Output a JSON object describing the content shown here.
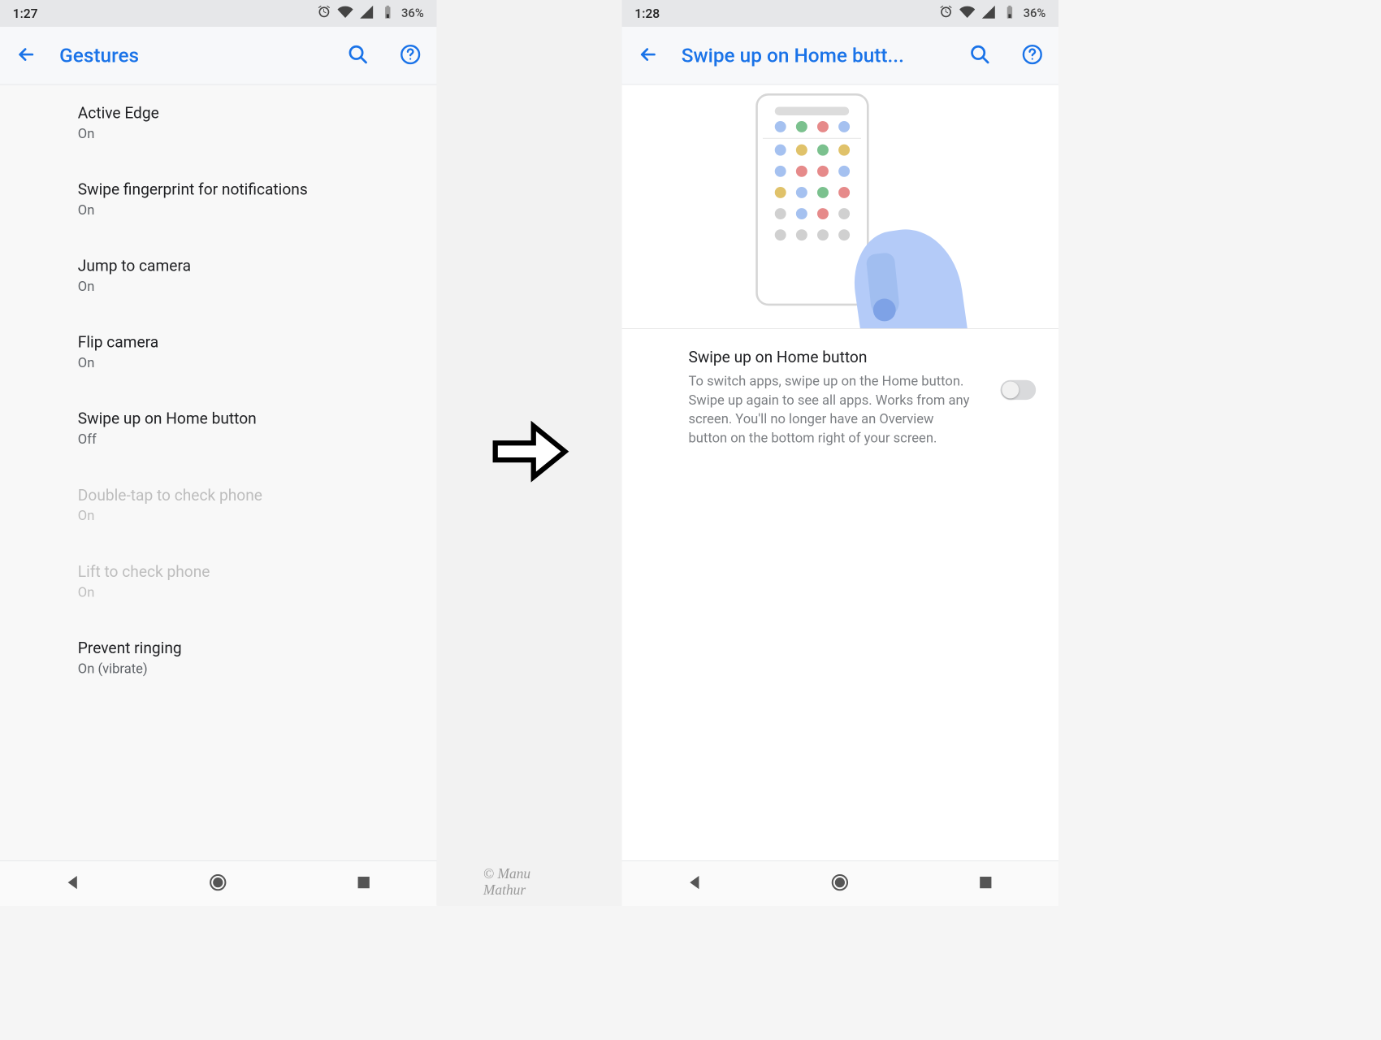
{
  "left": {
    "status": {
      "time": "1:27",
      "battery_pct": "36%"
    },
    "appbar": {
      "title": "Gestures"
    },
    "items": [
      {
        "title": "Active Edge",
        "sub": "On",
        "disabled": false
      },
      {
        "title": "Swipe fingerprint for notifications",
        "sub": "On",
        "disabled": false
      },
      {
        "title": "Jump to camera",
        "sub": "On",
        "disabled": false
      },
      {
        "title": "Flip camera",
        "sub": "On",
        "disabled": false
      },
      {
        "title": "Swipe up on Home button",
        "sub": "Off",
        "disabled": false
      },
      {
        "title": "Double-tap to check phone",
        "sub": "On",
        "disabled": true
      },
      {
        "title": "Lift to check phone",
        "sub": "On",
        "disabled": true
      },
      {
        "title": "Prevent ringing",
        "sub": "On (vibrate)",
        "disabled": false
      }
    ]
  },
  "right": {
    "status": {
      "time": "1:28",
      "battery_pct": "36%"
    },
    "appbar": {
      "title": "Swipe up on Home butt..."
    },
    "detail": {
      "title": "Swipe up on Home button",
      "desc": "To switch apps, swipe up on the Home button. Swipe up again to see all apps. Works from any screen. You'll no longer have an Overview button on the bottom right of your screen.",
      "toggle_on": false
    }
  },
  "watermark": "© Manu Mathur",
  "illus_dots_row1": [
    "#a5c1f0",
    "#7bc18e",
    "#e68a8a",
    "#a5c1f0"
  ],
  "illus_dots_rest": [
    "#a5c1f0",
    "#e0c26a",
    "#7bc18e",
    "#e0c26a",
    "#a5c1f0",
    "#e68a8a",
    "#e68a8a",
    "#a5c1f0",
    "#e0c26a",
    "#a5c1f0",
    "#7bc18e",
    "#e68a8a",
    "#d0d0d0",
    "#a5c1f0",
    "#e68a8a",
    "#d0d0d0",
    "#d0d0d0",
    "#d0d0d0",
    "#d0d0d0",
    "#d0d0d0"
  ]
}
